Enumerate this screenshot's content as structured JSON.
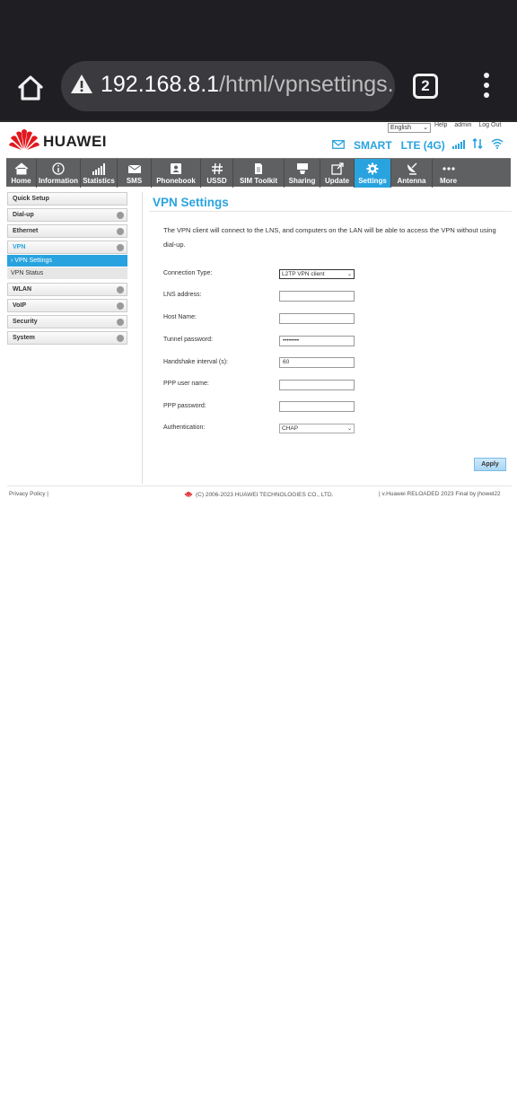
{
  "browser": {
    "url_host": "192.168.8.1",
    "url_path": "/html/vpnsettings.h",
    "tab_count": "2"
  },
  "brand": {
    "logo_text": "HUAWEI",
    "accent_color": "#29a3df",
    "nav_bg_color": "#5f6062"
  },
  "topbar": {
    "language": "English",
    "help": "Help",
    "user": "admin",
    "logout": "Log Out",
    "carrier": "SMART",
    "network": "LTE (4G)"
  },
  "nav": {
    "items": [
      {
        "label": "Home",
        "icon": "home-icon"
      },
      {
        "label": "Information",
        "icon": "info-icon"
      },
      {
        "label": "Statistics",
        "icon": "statistics-icon"
      },
      {
        "label": "SMS",
        "icon": "mail-icon"
      },
      {
        "label": "Phonebook",
        "icon": "phonebook-icon"
      },
      {
        "label": "USSD",
        "icon": "hash-icon"
      },
      {
        "label": "SIM Toolkit",
        "icon": "sim-icon"
      },
      {
        "label": "Sharing",
        "icon": "sharing-icon"
      },
      {
        "label": "Update",
        "icon": "update-icon"
      },
      {
        "label": "Settings",
        "icon": "gear-icon"
      },
      {
        "label": "Antenna",
        "icon": "antenna-icon"
      },
      {
        "label": "More",
        "icon": "more-icon"
      }
    ]
  },
  "sidebar": {
    "items": [
      {
        "label": "Quick Setup"
      },
      {
        "label": "Dial-up"
      },
      {
        "label": "Ethernet"
      },
      {
        "label": "VPN"
      },
      {
        "label": "WLAN"
      },
      {
        "label": "VoIP"
      },
      {
        "label": "Security"
      },
      {
        "label": "System"
      }
    ],
    "vpn_sub": [
      {
        "label": "› VPN Settings"
      },
      {
        "label": "VPN Status"
      }
    ]
  },
  "main": {
    "title": "VPN Settings",
    "description": "The VPN client will connect to the LNS, and computers on the LAN will be able to access the VPN without using dial-up.",
    "fields": {
      "connection_type": {
        "label": "Connection Type:",
        "value": "L2TP VPN client"
      },
      "lns_address": {
        "label": "LNS address:",
        "value": ""
      },
      "host_name": {
        "label": "Host Name:",
        "value": ""
      },
      "tunnel_password": {
        "label": "Tunnel password:",
        "value": "••••••••"
      },
      "handshake": {
        "label": "Handshake interval (s):",
        "value": "60"
      },
      "ppp_user": {
        "label": "PPP user name:",
        "value": ""
      },
      "ppp_password": {
        "label": "PPP password:",
        "value": ""
      },
      "authentication": {
        "label": "Authentication:",
        "value": "CHAP"
      }
    },
    "apply_label": "Apply"
  },
  "footer": {
    "privacy": "Privacy Policy |",
    "copyright": "(C) 2006-2023 HUAWEI TECHNOLOGIES CO., LTD.",
    "version": "| v.Huawei RELOADED 2023 Final by jhowel22"
  }
}
